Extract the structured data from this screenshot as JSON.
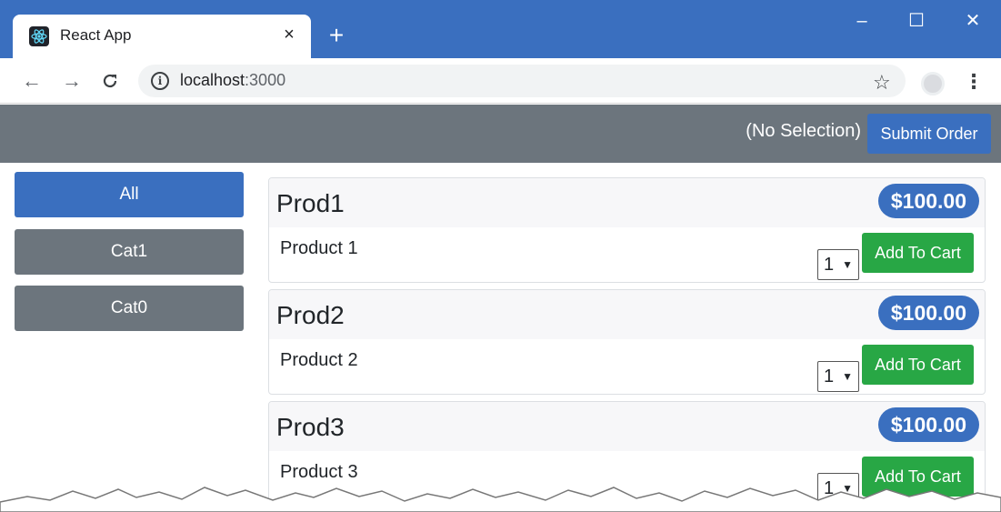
{
  "browser": {
    "tab_title": "React App",
    "tab_close": "×",
    "new_tab": "+",
    "url_host": "localhost",
    "url_port": ":3000",
    "window_controls": {
      "minimize": "–",
      "maximize": "☐",
      "close": "✕"
    }
  },
  "navbar": {
    "selection_text": "(No Selection)",
    "submit_label": "Submit Order"
  },
  "categories": [
    {
      "label": "All",
      "active": true
    },
    {
      "label": "Cat1",
      "active": false
    },
    {
      "label": "Cat0",
      "active": false
    }
  ],
  "products": [
    {
      "name": "Prod1",
      "price": "$100.00",
      "description": "Product 1",
      "quantity": "1",
      "add_label": "Add To Cart"
    },
    {
      "name": "Prod2",
      "price": "$100.00",
      "description": "Product 2",
      "quantity": "1",
      "add_label": "Add To Cart"
    },
    {
      "name": "Prod3",
      "price": "$100.00",
      "description": "Product 3",
      "quantity": "1",
      "add_label": "Add To Cart"
    }
  ],
  "colors": {
    "primary": "#3a6fbf",
    "secondary": "#6c757d",
    "success": "#28a745"
  }
}
